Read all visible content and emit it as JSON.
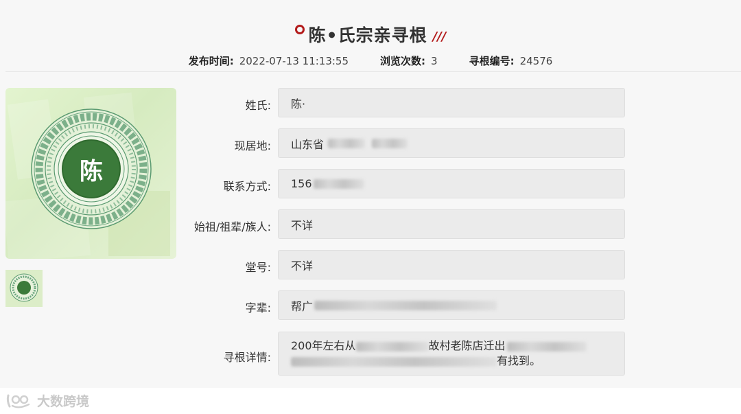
{
  "header": {
    "title": "陈•氏宗亲寻根",
    "slash": "///"
  },
  "meta": {
    "publish_label": "发布时间:",
    "publish_time": "2022-07-13 11:13:55",
    "views_label": "浏览次数:",
    "views": "3",
    "id_label": "寻根编号:",
    "id": "24576"
  },
  "image": {
    "character": "陈",
    "accent_color": "#3b7a3a",
    "ornament_color": "#5a9a70"
  },
  "fields": [
    {
      "label": "姓氏:",
      "value": "陈·"
    },
    {
      "label": "现居地:",
      "value": "山东省"
    },
    {
      "label": "联系方式:",
      "value": "156"
    },
    {
      "label": "始祖/祖辈/族人:",
      "value": "不详"
    },
    {
      "label": "堂号:",
      "value": "不详"
    },
    {
      "label": "字辈:",
      "value": "帮广"
    },
    {
      "label": "寻根详情:",
      "value_start": "200年左右从",
      "value_mid": "故村老陈店迁出",
      "value_end": "有找到。"
    }
  ],
  "watermark": {
    "text": "大数跨境"
  },
  "colors": {
    "accent_red": "#b31b1b",
    "box_bg": "#ebebeb"
  }
}
